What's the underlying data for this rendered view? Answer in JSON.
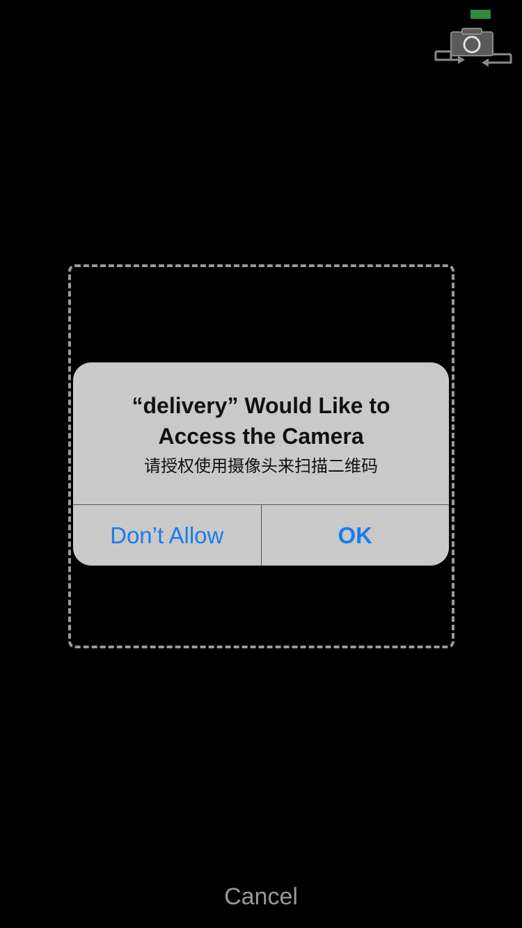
{
  "status_bar": {
    "battery_color": "#2e8b3e"
  },
  "toolbar": {
    "camera_switch_icon": "camera-switch-icon"
  },
  "alert": {
    "title": "“delivery” Would Like to Access the Camera",
    "message": "请授权使用摄像头来扫描二维码",
    "deny_label": "Don’t Allow",
    "ok_label": "OK"
  },
  "footer": {
    "cancel_label": "Cancel"
  },
  "colors": {
    "accent": "#1a7cf0",
    "background": "#000000",
    "alert_background": "#c9c9c9",
    "scan_frame": "#9a9a9a"
  }
}
